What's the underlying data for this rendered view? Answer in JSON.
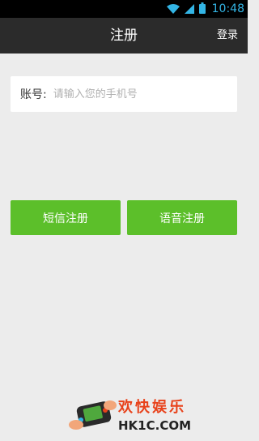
{
  "status_bar": {
    "time": "10:48",
    "icons": [
      "wifi-icon",
      "signal-icon",
      "battery-icon"
    ],
    "icon_color": "#33b5e5"
  },
  "header": {
    "title": "注册",
    "login_label": "登录",
    "background": "#2b2b2b"
  },
  "form": {
    "account_label": "账号:",
    "account_placeholder": "请输入您的手机号",
    "account_value": ""
  },
  "actions": {
    "sms_register_label": "短信注册",
    "voice_register_label": "语音注册",
    "button_color": "#5cbf2a"
  },
  "watermark": {
    "text_cn": "欢快娱乐",
    "text_en": "HK1C.COM"
  }
}
